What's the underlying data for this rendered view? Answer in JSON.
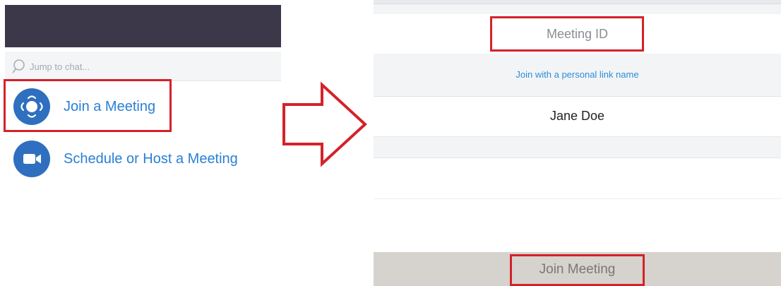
{
  "left_panel": {
    "search": {
      "placeholder": "Jump to chat..."
    },
    "menu": {
      "join": {
        "label": "Join a Meeting",
        "icon": "join-meeting-icon"
      },
      "schedule": {
        "label": "Schedule or Host a Meeting",
        "icon": "video-camera-icon"
      }
    }
  },
  "right_panel": {
    "meeting_id": {
      "placeholder": "Meeting ID"
    },
    "personal_link": "Join with a personal link name",
    "name": {
      "value": "Jane Doe"
    },
    "join_button": "Join Meeting"
  },
  "colors": {
    "header": "#3d3849",
    "accent_blue": "#2a7fd4",
    "icon_blue": "#2f6fbf",
    "highlight_red": "#d4222a",
    "join_bar": "#d6d2cd"
  }
}
